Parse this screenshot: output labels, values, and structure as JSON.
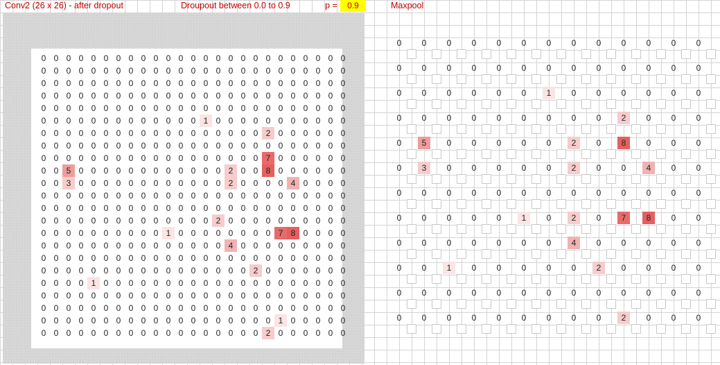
{
  "header": {
    "title": "Conv2 (26 x 26) - after dropout",
    "subtitle": "Droupout between 0.0 to 0.9",
    "p_label": "p =",
    "p_value": "0.9",
    "maxpool_title": "Maxpool"
  },
  "colors": {
    "title_text": "#c00000",
    "p_highlight": "#ffff00",
    "panel_background": "#d4d4d4",
    "heat_low": "#fbe4e4",
    "heat_high": "#e65f5f"
  },
  "conv_grid": [
    [
      0,
      0,
      0,
      0,
      0,
      0,
      0,
      0,
      0,
      0,
      0,
      0,
      0,
      0,
      0,
      0,
      0,
      0,
      0,
      0,
      0,
      0,
      0,
      0,
      0
    ],
    [
      0,
      0,
      0,
      0,
      0,
      0,
      0,
      0,
      0,
      0,
      0,
      0,
      0,
      0,
      0,
      0,
      0,
      0,
      0,
      0,
      0,
      0,
      0,
      0,
      0
    ],
    [
      0,
      0,
      0,
      0,
      0,
      0,
      0,
      0,
      0,
      0,
      0,
      0,
      0,
      0,
      0,
      0,
      0,
      0,
      0,
      0,
      0,
      0,
      0,
      0,
      0
    ],
    [
      0,
      0,
      0,
      0,
      0,
      0,
      0,
      0,
      0,
      0,
      0,
      0,
      0,
      0,
      0,
      0,
      0,
      0,
      0,
      0,
      0,
      0,
      0,
      0,
      0
    ],
    [
      0,
      0,
      0,
      0,
      0,
      0,
      0,
      0,
      0,
      0,
      0,
      0,
      0,
      0,
      0,
      0,
      0,
      0,
      0,
      0,
      0,
      0,
      0,
      0,
      0
    ],
    [
      0,
      0,
      0,
      0,
      0,
      0,
      0,
      0,
      0,
      0,
      0,
      0,
      0,
      1,
      0,
      0,
      0,
      0,
      0,
      0,
      0,
      0,
      0,
      0,
      0
    ],
    [
      0,
      0,
      0,
      0,
      0,
      0,
      0,
      0,
      0,
      0,
      0,
      0,
      0,
      0,
      0,
      0,
      0,
      0,
      2,
      0,
      0,
      0,
      0,
      0,
      0
    ],
    [
      0,
      0,
      0,
      0,
      0,
      0,
      0,
      0,
      0,
      0,
      0,
      0,
      0,
      0,
      0,
      0,
      0,
      0,
      0,
      0,
      0,
      0,
      0,
      0,
      0
    ],
    [
      0,
      0,
      0,
      0,
      0,
      0,
      0,
      0,
      0,
      0,
      0,
      0,
      0,
      0,
      0,
      0,
      0,
      0,
      7,
      0,
      0,
      0,
      0,
      0,
      0
    ],
    [
      0,
      0,
      5,
      0,
      0,
      0,
      0,
      0,
      0,
      0,
      0,
      0,
      0,
      0,
      0,
      2,
      0,
      0,
      8,
      0,
      0,
      0,
      0,
      0,
      0
    ],
    [
      0,
      0,
      3,
      0,
      0,
      0,
      0,
      0,
      0,
      0,
      0,
      0,
      0,
      0,
      0,
      2,
      0,
      0,
      0,
      0,
      4,
      0,
      0,
      0,
      0
    ],
    [
      0,
      0,
      0,
      0,
      0,
      0,
      0,
      0,
      0,
      0,
      0,
      0,
      0,
      0,
      0,
      0,
      0,
      0,
      0,
      0,
      0,
      0,
      0,
      0,
      0
    ],
    [
      0,
      0,
      0,
      0,
      0,
      0,
      0,
      0,
      0,
      0,
      0,
      0,
      0,
      0,
      0,
      0,
      0,
      0,
      0,
      0,
      0,
      0,
      0,
      0,
      0
    ],
    [
      0,
      0,
      0,
      0,
      0,
      0,
      0,
      0,
      0,
      0,
      0,
      0,
      0,
      0,
      2,
      0,
      0,
      0,
      0,
      0,
      0,
      0,
      0,
      0,
      0
    ],
    [
      0,
      0,
      0,
      0,
      0,
      0,
      0,
      0,
      0,
      0,
      1,
      0,
      0,
      0,
      0,
      0,
      0,
      0,
      0,
      7,
      8,
      0,
      0,
      0,
      0
    ],
    [
      0,
      0,
      0,
      0,
      0,
      0,
      0,
      0,
      0,
      0,
      0,
      0,
      0,
      0,
      0,
      4,
      0,
      0,
      0,
      0,
      0,
      0,
      0,
      0,
      0
    ],
    [
      0,
      0,
      0,
      0,
      0,
      0,
      0,
      0,
      0,
      0,
      0,
      0,
      0,
      0,
      0,
      0,
      0,
      0,
      0,
      0,
      0,
      0,
      0,
      0,
      0
    ],
    [
      0,
      0,
      0,
      0,
      0,
      0,
      0,
      0,
      0,
      0,
      0,
      0,
      0,
      0,
      0,
      0,
      0,
      2,
      0,
      0,
      0,
      0,
      0,
      0,
      0
    ],
    [
      0,
      0,
      0,
      0,
      1,
      0,
      0,
      0,
      0,
      0,
      0,
      0,
      0,
      0,
      0,
      0,
      0,
      0,
      0,
      0,
      0,
      0,
      0,
      0,
      0
    ],
    [
      0,
      0,
      0,
      0,
      0,
      0,
      0,
      0,
      0,
      0,
      0,
      0,
      0,
      0,
      0,
      0,
      0,
      0,
      0,
      0,
      0,
      0,
      0,
      0,
      0
    ],
    [
      0,
      0,
      0,
      0,
      0,
      0,
      0,
      0,
      0,
      0,
      0,
      0,
      0,
      0,
      0,
      0,
      0,
      0,
      0,
      0,
      0,
      0,
      0,
      0,
      0
    ],
    [
      0,
      0,
      0,
      0,
      0,
      0,
      0,
      0,
      0,
      0,
      0,
      0,
      0,
      0,
      0,
      0,
      0,
      0,
      0,
      1,
      0,
      0,
      0,
      0,
      0
    ],
    [
      0,
      0,
      0,
      0,
      0,
      0,
      0,
      0,
      0,
      0,
      0,
      0,
      0,
      0,
      0,
      0,
      0,
      0,
      2,
      0,
      0,
      0,
      0,
      0,
      0
    ]
  ],
  "maxpool_grid": [
    [
      0,
      0,
      0,
      0,
      0,
      0,
      0,
      0,
      0,
      0,
      0,
      0,
      0
    ],
    [
      0,
      0,
      0,
      0,
      0,
      0,
      0,
      0,
      0,
      0,
      0,
      0,
      0
    ],
    [
      0,
      0,
      0,
      0,
      0,
      0,
      1,
      0,
      0,
      0,
      0,
      0,
      0
    ],
    [
      0,
      0,
      0,
      0,
      0,
      0,
      0,
      0,
      0,
      2,
      0,
      0,
      0
    ],
    [
      0,
      5,
      0,
      0,
      0,
      0,
      0,
      2,
      0,
      8,
      0,
      0,
      0
    ],
    [
      0,
      3,
      0,
      0,
      0,
      0,
      0,
      2,
      0,
      0,
      4,
      0,
      0
    ],
    [
      0,
      0,
      0,
      0,
      0,
      0,
      0,
      0,
      0,
      0,
      0,
      0,
      0
    ],
    [
      0,
      0,
      0,
      0,
      0,
      1,
      0,
      2,
      0,
      7,
      8,
      0,
      0
    ],
    [
      0,
      0,
      0,
      0,
      0,
      0,
      0,
      4,
      0,
      0,
      0,
      0,
      0
    ],
    [
      0,
      0,
      1,
      0,
      0,
      0,
      0,
      0,
      2,
      0,
      0,
      0,
      0
    ],
    [
      0,
      0,
      0,
      0,
      0,
      0,
      0,
      0,
      0,
      0,
      0,
      0,
      0
    ],
    [
      0,
      0,
      0,
      0,
      0,
      0,
      0,
      0,
      0,
      2,
      0,
      0,
      0
    ]
  ]
}
